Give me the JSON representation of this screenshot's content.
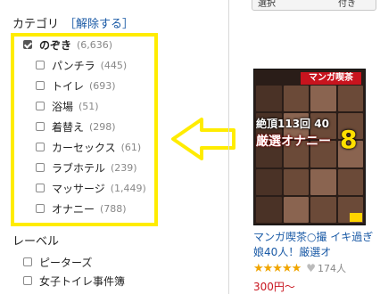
{
  "category": {
    "heading": "カテゴリ",
    "clear_link": "［解除する］",
    "items": [
      {
        "label": "のぞき",
        "count": "(6,636)",
        "checked": true
      },
      {
        "label": "パンチラ",
        "count": "(445)"
      },
      {
        "label": "トイレ",
        "count": "(693)"
      },
      {
        "label": "浴場",
        "count": "(51)"
      },
      {
        "label": "着替え",
        "count": "(298)"
      },
      {
        "label": "カーセックス",
        "count": "(61)"
      },
      {
        "label": "ラブホテル",
        "count": "(239)"
      },
      {
        "label": "マッサージ",
        "count": "(1,449)"
      },
      {
        "label": "オナニー",
        "count": "(788)"
      }
    ]
  },
  "label_section": {
    "heading": "レーベル",
    "items": [
      {
        "label": "ピーターズ"
      },
      {
        "label": "女子トイレ事件簿"
      }
    ]
  },
  "top_buttons": {
    "left": "選択",
    "right": "付き"
  },
  "product": {
    "cover": {
      "banner": "マンガ喫茶",
      "line1": "絶頂113回 40",
      "line2": "厳選オナニー",
      "big": "8"
    },
    "title": "マンガ喫茶○撮 イキ過ぎ娘40人！厳選オ",
    "rating_stars": "★★★★★",
    "likes": "174人",
    "price": "300円～"
  },
  "colors": {
    "highlight": "#ffec00",
    "link": "#1a5aa6",
    "price": "#c8141e",
    "star": "#f0a500"
  }
}
